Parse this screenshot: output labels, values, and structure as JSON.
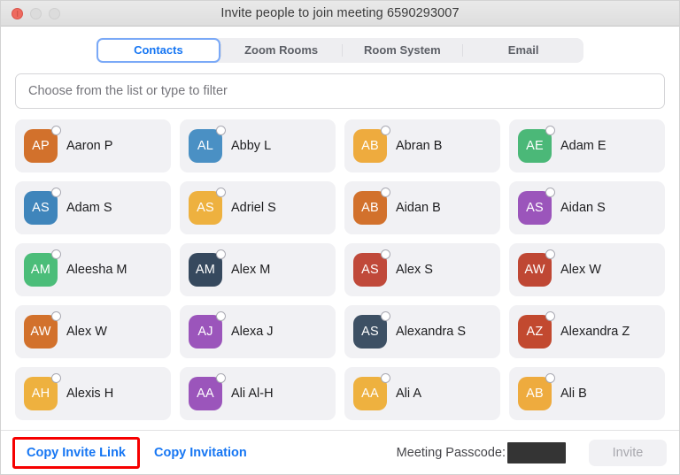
{
  "window": {
    "title": "Invite people to join meeting 6590293007",
    "traffic_lights": [
      "close",
      "minimize",
      "maximize"
    ]
  },
  "tabs": [
    {
      "label": "Contacts",
      "active": true
    },
    {
      "label": "Zoom Rooms",
      "active": false
    },
    {
      "label": "Room System",
      "active": false
    },
    {
      "label": "Email",
      "active": false
    }
  ],
  "search": {
    "placeholder": "Choose from the list or type to filter",
    "value": ""
  },
  "contacts": [
    {
      "name": "Aaron P",
      "initials": "AP",
      "color": "#d2712c"
    },
    {
      "name": "Abby L",
      "initials": "AL",
      "color": "#4a90c4"
    },
    {
      "name": "Abran B",
      "initials": "AB",
      "color": "#eeab3e"
    },
    {
      "name": "Adam E",
      "initials": "AE",
      "color": "#4bb878"
    },
    {
      "name": "Adam S",
      "initials": "AS",
      "color": "#3f85bb"
    },
    {
      "name": "Adriel S",
      "initials": "AS",
      "color": "#eeb13f"
    },
    {
      "name": "Aidan B",
      "initials": "AB",
      "color": "#d2712c"
    },
    {
      "name": "Aidan S",
      "initials": "AS",
      "color": "#9b55bb"
    },
    {
      "name": "Aleesha M",
      "initials": "AM",
      "color": "#4bbd79"
    },
    {
      "name": "Alex M",
      "initials": "AM",
      "color": "#36495e"
    },
    {
      "name": "Alex S",
      "initials": "AS",
      "color": "#c0493a"
    },
    {
      "name": "Alex W",
      "initials": "AW",
      "color": "#bf4734"
    },
    {
      "name": "Alex W",
      "initials": "AW",
      "color": "#d2712c"
    },
    {
      "name": "Alexa J",
      "initials": "AJ",
      "color": "#9b55bb"
    },
    {
      "name": "Alexandra S",
      "initials": "AS",
      "color": "#3d5064"
    },
    {
      "name": "Alexandra Z",
      "initials": "AZ",
      "color": "#c2492f"
    },
    {
      "name": "Alexis H",
      "initials": "AH",
      "color": "#eeb13f"
    },
    {
      "name": "Ali Al-H",
      "initials": "AA",
      "color": "#9b55bb"
    },
    {
      "name": "Ali A",
      "initials": "AA",
      "color": "#eeb13f"
    },
    {
      "name": "Ali B",
      "initials": "AB",
      "color": "#eeab3e"
    }
  ],
  "footer": {
    "copy_invite_link_label": "Copy Invite Link",
    "copy_invitation_label": "Copy Invitation",
    "passcode_label": "Meeting Passcode:",
    "passcode_value": "",
    "invite_button_label": "Invite"
  },
  "colors": {
    "accent_link": "#1676f3",
    "highlight_box": "#f60000",
    "card_background": "#f1f1f4"
  }
}
